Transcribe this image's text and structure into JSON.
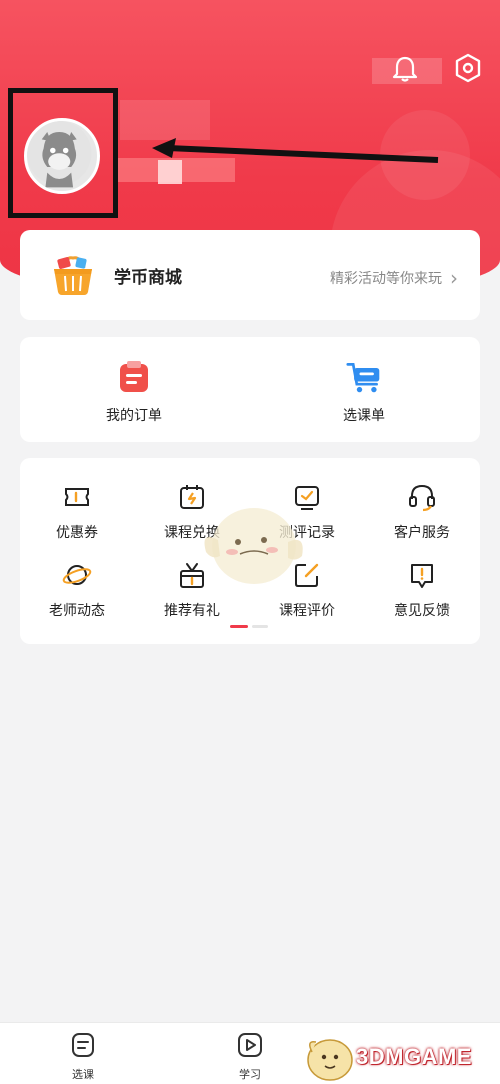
{
  "header": {
    "bell_icon": "bell-icon",
    "settings_icon": "settings-icon"
  },
  "shop": {
    "title": "学币商城",
    "subtitle": "精彩活动等你来玩",
    "chevron": "›"
  },
  "orders": {
    "items": [
      {
        "label": "我的订单",
        "icon": "order-icon"
      },
      {
        "label": "选课单",
        "icon": "cart-icon"
      }
    ]
  },
  "services": {
    "items": [
      {
        "label": "优惠券",
        "icon": "coupon-icon"
      },
      {
        "label": "课程兑换",
        "icon": "exchange-icon"
      },
      {
        "label": "测评记录",
        "icon": "evaluation-record-icon"
      },
      {
        "label": "客户服务",
        "icon": "headset-icon"
      },
      {
        "label": "老师动态",
        "icon": "planet-icon"
      },
      {
        "label": "推荐有礼",
        "icon": "gift-icon"
      },
      {
        "label": "课程评价",
        "icon": "edit-icon"
      },
      {
        "label": "意见反馈",
        "icon": "feedback-icon"
      }
    ]
  },
  "tabbar": {
    "items": [
      {
        "label": "选课",
        "icon": "course-list-icon"
      },
      {
        "label": "学习",
        "icon": "play-icon"
      }
    ]
  },
  "watermark": {
    "text": "3DMGAME"
  },
  "colors": {
    "brand_red": "#f03a4a",
    "accent_orange": "#f5a023",
    "accent_blue": "#2f8df0"
  }
}
